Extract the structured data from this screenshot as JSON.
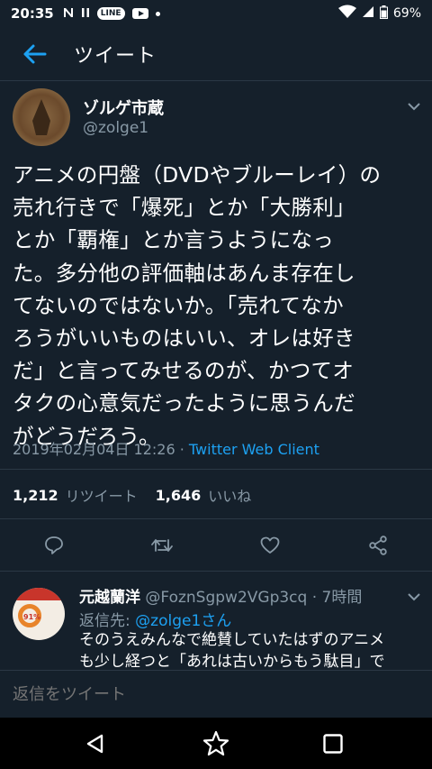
{
  "status_bar": {
    "time": "20:35",
    "notif_pill": "LINE",
    "battery": "69%",
    "icons": [
      "n-icon",
      "pause-icon",
      "line-icon",
      "youtube-icon",
      "dot-icon",
      "wifi-icon",
      "signal-icon",
      "battery-icon"
    ]
  },
  "header": {
    "title": "ツイート",
    "back_icon": "arrow-left-icon"
  },
  "tweet": {
    "display_name": "ゾルゲ市蔵",
    "handle": "@zolge1",
    "lines": [
      "アニメの円盤（DVDやブルーレイ）の",
      "売れ行きで「爆死」とか「大勝利」",
      "とか「覇権」とか言うようになっ",
      "た。多分他の評価軸はあんま存在し",
      "てないのではないか。「売れてなか",
      "ろうがいいものはいい、オレは好き",
      "だ」と言ってみせるのが、かつてオ",
      "タクの心意気だったように思うんだ",
      "がどうだろう。"
    ],
    "timestamp": "2019年02月04日 12:26 ·",
    "client": "Twitter Web Client",
    "retweet_count": "1,212",
    "retweet_label": "リツイート",
    "like_count": "1,646",
    "like_label": "いいね"
  },
  "reply": {
    "name": "元越蘭洋",
    "handle_time": "@FoznSgpw2VGp3cq · 7時間",
    "reply_to_label": "返信先:",
    "reply_to_mention": "@zolge1さん",
    "text_line1": "そのうえみんなで絶賛していたはずのアニメ",
    "text_line2": "も少し経つと「あれは古いからもう駄目」で",
    "avatar_text": "91%"
  },
  "compose": {
    "placeholder": "返信をツイート"
  },
  "colors": {
    "background": "#15202b",
    "accent": "#1da1f2",
    "secondary_text": "#8899a6",
    "divider": "#2b3845"
  }
}
